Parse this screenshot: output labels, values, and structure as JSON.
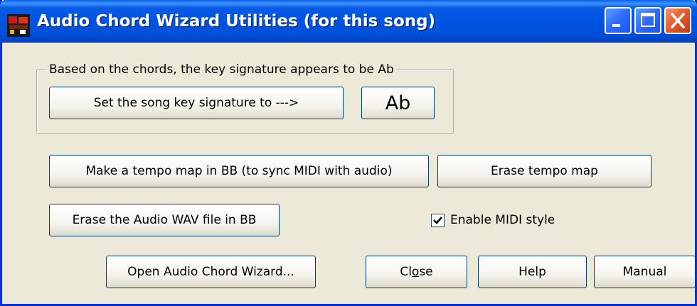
{
  "window": {
    "title": "Audio Chord Wizard Utilities (for this song)",
    "controls": {
      "minimize": "minimize-icon",
      "maximize": "maximize-icon",
      "close": "close-icon"
    }
  },
  "key_group": {
    "label": "Based on the chords, the key signature appears to be Ab",
    "set_button": "Set the song key signature to --->",
    "key_value": "Ab"
  },
  "buttons": {
    "tempo_map": "Make a tempo map in BB (to sync MIDI with audio)",
    "erase_tempo": "Erase tempo map",
    "erase_wav": "Erase the Audio WAV file in BB",
    "open_wizard": "Open Audio Chord Wizard...",
    "close_prefix": "Cl",
    "close_mnemonic": "o",
    "close_suffix": "se",
    "help": "Help",
    "manual": "Manual"
  },
  "checkbox": {
    "label": "Enable MIDI style",
    "checked": true
  },
  "colors": {
    "titlebar": "#0054e3",
    "face": "#ece9d8",
    "close": "#e25a2d"
  }
}
